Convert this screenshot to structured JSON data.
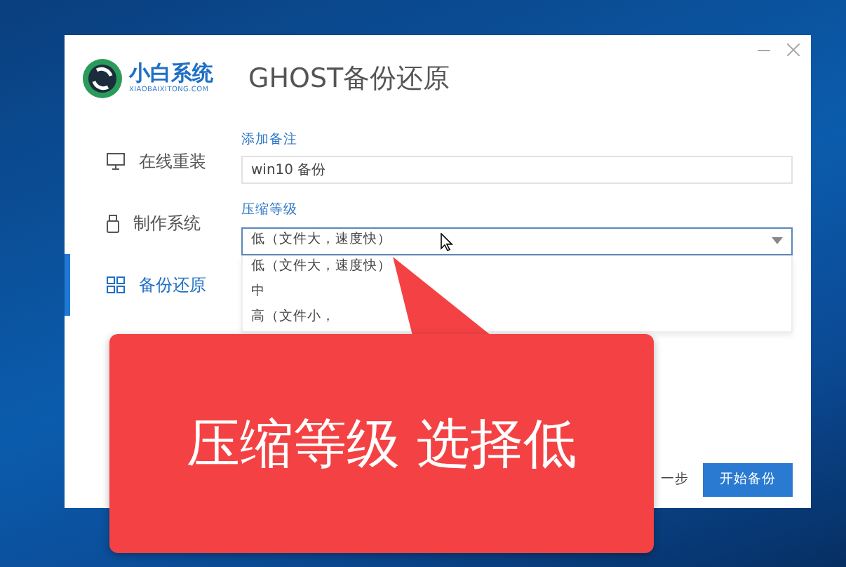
{
  "window": {
    "logo": {
      "name": "小白系统",
      "domain": "XIAOBAIXITONG.COM"
    },
    "title": "GHOST备份还原"
  },
  "sidebar": {
    "items": [
      {
        "label": "在线重装",
        "kind": "monitor",
        "selected": false
      },
      {
        "label": "制作系统",
        "kind": "usb",
        "selected": false
      },
      {
        "label": "备份还原",
        "kind": "grid",
        "selected": true
      }
    ]
  },
  "form": {
    "remark": {
      "label": "添加备注",
      "value": "win10 备份"
    },
    "compression": {
      "label": "压缩等级",
      "value": "低（文件大，速度快）",
      "expanded": true,
      "options": [
        {
          "label": "低（文件大，速度快）"
        },
        {
          "label": "中"
        },
        {
          "label": "高（文件小，"
        }
      ]
    }
  },
  "buttons": [
    {
      "label": "一步",
      "kind": "link"
    },
    {
      "label": "开始备份",
      "kind": "primary"
    }
  ],
  "callout": {
    "text": "压缩等级 选择低"
  }
}
